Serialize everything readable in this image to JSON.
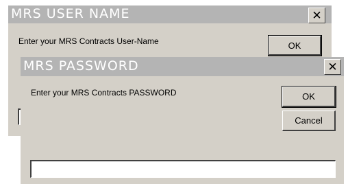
{
  "user_dialog": {
    "title": "MRS USER NAME",
    "prompt": "Enter your MRS Contracts User-Name",
    "ok_label": "OK",
    "close_glyph": "✕",
    "input_value": ""
  },
  "password_dialog": {
    "title": "MRS PASSWORD",
    "prompt": "Enter your MRS Contracts PASSWORD",
    "ok_label": "OK",
    "cancel_label": "Cancel",
    "close_glyph": "✕",
    "input_value": ""
  }
}
